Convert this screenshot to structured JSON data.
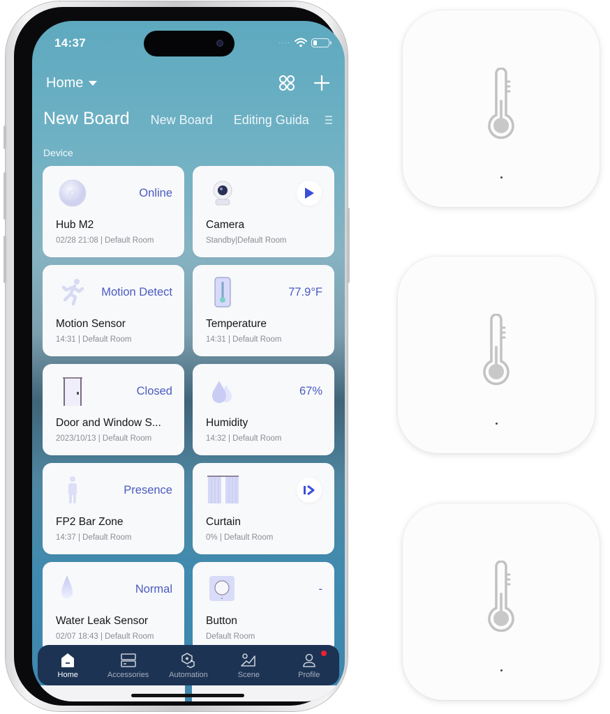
{
  "status_bar": {
    "time": "14:37",
    "signal_icon": "signal-dots-icon",
    "wifi_icon": "wifi-icon",
    "battery_icon": "battery-low-icon"
  },
  "header": {
    "home_selector": "Home",
    "caret_icon": "caret-down-icon",
    "grid_icon": "grid-view-icon",
    "add_icon": "plus-icon"
  },
  "tabs": [
    {
      "label": "New Board",
      "active": true
    },
    {
      "label": "New Board",
      "active": false
    },
    {
      "label": "Editing Guida",
      "active": false
    }
  ],
  "tabs_menu_icon": "menu-icon",
  "section_label": "Device",
  "devices": [
    {
      "name": "Hub M2",
      "state": "Online",
      "subtitle": "02/28 21:08 | Default Room",
      "icon": "hub-icon",
      "action": null
    },
    {
      "name": "Camera",
      "state": "",
      "subtitle": "Standby|Default Room",
      "icon": "camera-icon",
      "action": "play-icon"
    },
    {
      "name": "Motion Sensor",
      "state": "Motion Detect",
      "subtitle": "14:31 | Default Room",
      "icon": "running-person-icon",
      "action": null
    },
    {
      "name": "Temperature",
      "state": "77.9°F",
      "subtitle": "14:31 | Default Room",
      "icon": "thermometer-icon",
      "action": null
    },
    {
      "name": "Door and Window S...",
      "state": "Closed",
      "subtitle": "2023/10/13 | Default Room",
      "icon": "door-icon",
      "action": null
    },
    {
      "name": "Humidity",
      "state": "67%",
      "subtitle": "14:32 | Default Room",
      "icon": "water-drops-icon",
      "action": null
    },
    {
      "name": "FP2 Bar Zone",
      "state": "Presence",
      "subtitle": "14:37 | Default Room",
      "icon": "person-icon",
      "action": null
    },
    {
      "name": "Curtain",
      "state": "",
      "subtitle": "0% | Default Room",
      "icon": "curtain-icon",
      "action": "open-curtain-icon"
    },
    {
      "name": "Water Leak Sensor",
      "state": "Normal",
      "subtitle": "02/07 18:43 | Default Room",
      "icon": "water-drop-icon",
      "action": null
    },
    {
      "name": "Button",
      "state": "-",
      "subtitle": "Default Room",
      "icon": "wireless-button-icon",
      "action": null
    }
  ],
  "bottom_nav": [
    {
      "label": "Home",
      "icon": "home-icon",
      "active": true,
      "badge": false
    },
    {
      "label": "Accessories",
      "icon": "accessories-icon",
      "active": false,
      "badge": false
    },
    {
      "label": "Automation",
      "icon": "automation-icon",
      "active": false,
      "badge": false
    },
    {
      "label": "Scene",
      "icon": "scene-icon",
      "active": false,
      "badge": false
    },
    {
      "label": "Profile",
      "icon": "profile-icon",
      "active": false,
      "badge": true
    }
  ],
  "colors": {
    "accent": "#4b5bc0",
    "nav_bg": "#1c3354",
    "badge": "#ee2233",
    "card_bg": "#f8f9fb"
  },
  "product_images": [
    {
      "label": "temperature-humidity-sensor",
      "icon": "thermometer-icon"
    },
    {
      "label": "temperature-humidity-sensor",
      "icon": "thermometer-icon"
    },
    {
      "label": "temperature-humidity-sensor",
      "icon": "thermometer-icon"
    }
  ]
}
